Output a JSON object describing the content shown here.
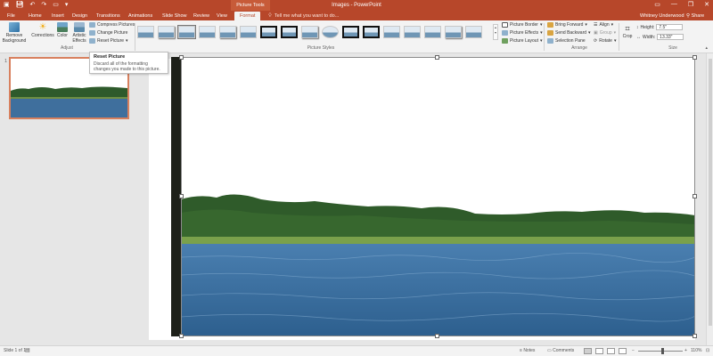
{
  "window": {
    "doc_title": "Images - PowerPoint",
    "context_tab_group": "Picture Tools",
    "user_name": "Whitney Underwood",
    "share_label": "Share"
  },
  "tabs": [
    {
      "label": "File"
    },
    {
      "label": "Home"
    },
    {
      "label": "Insert"
    },
    {
      "label": "Design"
    },
    {
      "label": "Transitions"
    },
    {
      "label": "Animations"
    },
    {
      "label": "Slide Show"
    },
    {
      "label": "Review"
    },
    {
      "label": "View"
    },
    {
      "label": "Format",
      "active": true
    }
  ],
  "tell_me": "Tell me what you want to do...",
  "ribbon": {
    "adjust": {
      "remove_background": "Remove Background",
      "corrections": "Corrections",
      "color": "Color",
      "artistic_effects": "Artistic Effects",
      "compress_pictures": "Compress Pictures",
      "change_picture": "Change Picture",
      "reset_picture": "Reset Picture",
      "group_label": "Adjust"
    },
    "picture_styles": {
      "group_label": "Picture Styles",
      "picture_border": "Picture Border",
      "picture_effects": "Picture Effects",
      "picture_layout": "Picture Layout"
    },
    "arrange": {
      "bring_forward": "Bring Forward",
      "send_backward": "Send Backward",
      "selection_pane": "Selection Pane",
      "align": "Align",
      "group": "Group",
      "rotate": "Rotate",
      "group_label": "Arrange"
    },
    "size": {
      "crop": "Crop",
      "height_label": "Height:",
      "height_value": "7.5\"",
      "width_label": "Width:",
      "width_value": "13.33\"",
      "group_label": "Size"
    }
  },
  "tooltip": {
    "title": "Reset Picture",
    "body": "Discard all of the formatting changes you made to this picture."
  },
  "slide_pane": {
    "slide_number": "1"
  },
  "statusbar": {
    "slide_info": "Slide 1 of 1",
    "notes": "Notes",
    "comments": "Comments",
    "zoom": "110%"
  },
  "colors": {
    "accent": "#b7472a",
    "ribbon_bg": "#f3f3f3",
    "workspace_bg": "#e6e6e6"
  }
}
